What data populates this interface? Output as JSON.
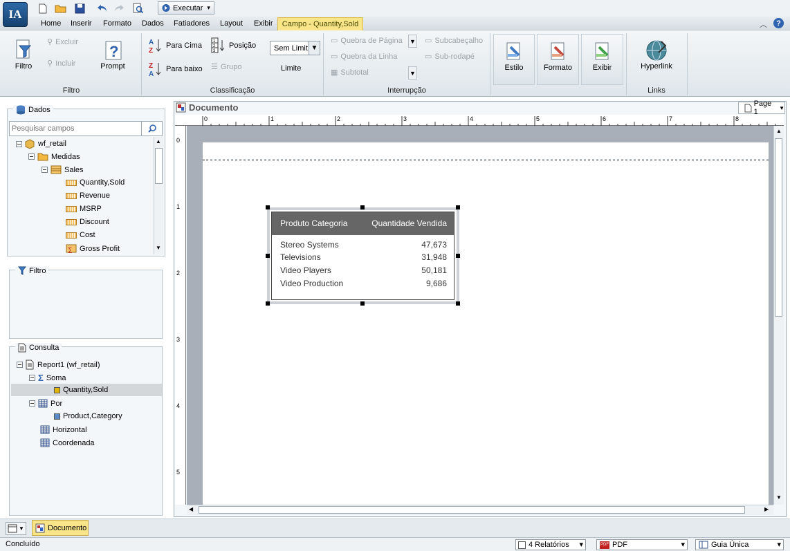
{
  "app": {
    "logo_text": "IA",
    "run_label": "Executar"
  },
  "menu": {
    "items": [
      "Home",
      "Inserir",
      "Formato",
      "Dados",
      "Fatiadores",
      "Layout",
      "Exibir"
    ],
    "context_tab": "Campo - Quantity,Sold"
  },
  "ribbon": {
    "filter_group": {
      "label": "Filtro",
      "filtro": "Filtro",
      "excluir": "Excluir",
      "incluir": "Incluir",
      "prompt": "Prompt"
    },
    "sort_group": {
      "label": "Classificação",
      "up": "Para Cima",
      "down": "Para baixo",
      "position": "Posição",
      "group": "Grupo",
      "limit_value": "Sem Limit",
      "limit": "Limite"
    },
    "break_group": {
      "label": "Interrupção",
      "page_break": "Quebra de Página",
      "line_break": "Quebra da Linha",
      "subtotal": "Subtotal",
      "subheader": "Subcabeçalho",
      "subfooter": "Sub-rodapé"
    },
    "style_group": {
      "estilo": "Estilo",
      "formato": "Formato",
      "exibir": "Exibir"
    },
    "links_group": {
      "label": "Links",
      "hyperlink": "Hyperlink"
    }
  },
  "dados": {
    "title": "Dados",
    "search_placeholder": "Pesquisar campos",
    "tree": {
      "root": "wf_retail",
      "medidas": "Medidas",
      "sales": "Sales",
      "fields": [
        "Quantity,Sold",
        "Revenue",
        "MSRP",
        "Discount",
        "Cost",
        "Gross Profit"
      ]
    }
  },
  "filtro": {
    "title": "Filtro"
  },
  "consulta": {
    "title": "Consulta",
    "report": "Report1 (wf_retail)",
    "soma": "Soma",
    "soma_field": "Quantity,Sold",
    "por": "Por",
    "por_field": "Product,Category",
    "horizontal": "Horizontal",
    "coordenada": "Coordenada"
  },
  "document": {
    "title": "Documento",
    "page_label": "Page 1",
    "ruler_marks": [
      "0",
      "1",
      "2",
      "3",
      "4",
      "5",
      "6",
      "7",
      "8"
    ],
    "ruler_left_marks": [
      "0",
      "1",
      "2",
      "3",
      "4",
      "5"
    ],
    "report": {
      "headers": [
        "Produto Categoria",
        "Quantidade Vendida"
      ],
      "rows": [
        {
          "category": "Stereo Systems",
          "qty": "47,673"
        },
        {
          "category": "Televisions",
          "qty": "31,948"
        },
        {
          "category": "Video Players",
          "qty": "50,181"
        },
        {
          "category": "Video Production",
          "qty": "9,686"
        }
      ]
    }
  },
  "bottom_tab": "Documento",
  "status": {
    "text": "Concluído",
    "reports": "4 Relatórios",
    "format": "PDF",
    "guide": "Guia Única"
  },
  "colors": {
    "accent": "#2e6aa8",
    "context_tab": "#f8e58a",
    "report_header": "#666666"
  }
}
